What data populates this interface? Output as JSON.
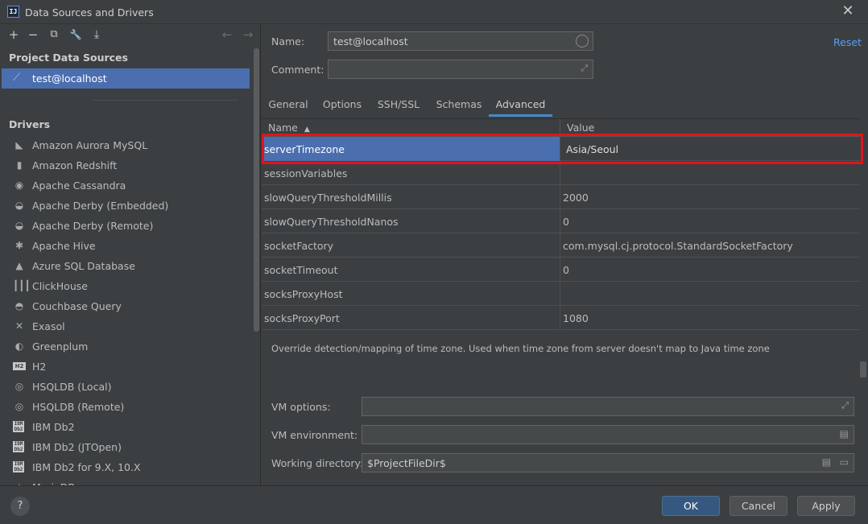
{
  "window": {
    "title": "Data Sources and Drivers",
    "app_icon": "IJ"
  },
  "left_panel": {
    "toolbar": {
      "add": "+",
      "remove": "−",
      "copy": "⧉",
      "properties": "🔧",
      "import": "⤓",
      "back": "←",
      "forward": "→"
    },
    "project_heading": "Project Data Sources",
    "data_sources": [
      {
        "label": "test@localhost",
        "icon": "mysql-icon"
      }
    ],
    "drivers_heading": "Drivers",
    "drivers": [
      {
        "label": "Amazon Aurora MySQL",
        "icon": "aurora-icon",
        "glyph": "◣"
      },
      {
        "label": "Amazon Redshift",
        "icon": "redshift-icon",
        "glyph": "▮"
      },
      {
        "label": "Apache Cassandra",
        "icon": "cassandra-icon",
        "glyph": "◉"
      },
      {
        "label": "Apache Derby (Embedded)",
        "icon": "derby-icon",
        "glyph": "◒"
      },
      {
        "label": "Apache Derby (Remote)",
        "icon": "derby-icon",
        "glyph": "◒"
      },
      {
        "label": "Apache Hive",
        "icon": "hive-icon",
        "glyph": "✱"
      },
      {
        "label": "Azure SQL Database",
        "icon": "azure-icon",
        "glyph": "▲"
      },
      {
        "label": "ClickHouse",
        "icon": "clickhouse-icon",
        "glyph": "┃┃┃"
      },
      {
        "label": "Couchbase Query",
        "icon": "couchbase-icon",
        "glyph": "◓"
      },
      {
        "label": "Exasol",
        "icon": "exasol-icon",
        "glyph": "✕"
      },
      {
        "label": "Greenplum",
        "icon": "greenplum-icon",
        "glyph": "◐"
      },
      {
        "label": "H2",
        "icon": "h2-icon",
        "glyph": "H2"
      },
      {
        "label": "HSQLDB (Local)",
        "icon": "hsqldb-icon",
        "glyph": "◎"
      },
      {
        "label": "HSQLDB (Remote)",
        "icon": "hsqldb-icon",
        "glyph": "◎"
      },
      {
        "label": "IBM Db2",
        "icon": "ibm-icon",
        "glyph": "IBM Db2"
      },
      {
        "label": "IBM Db2 (JTOpen)",
        "icon": "ibm-icon",
        "glyph": "IBM Db2"
      },
      {
        "label": "IBM Db2 for 9.X, 10.X",
        "icon": "ibm-icon",
        "glyph": "IBM Db2"
      },
      {
        "label": "MariaDB",
        "icon": "mariadb-icon",
        "glyph": "≀"
      }
    ]
  },
  "form": {
    "name_label": "Name:",
    "name_value": "test@localhost",
    "comment_label": "Comment:",
    "comment_value": "",
    "reset_link": "Reset",
    "expand_glyph": "⤢"
  },
  "tabs": [
    {
      "label": "General"
    },
    {
      "label": "Options"
    },
    {
      "label": "SSH/SSL"
    },
    {
      "label": "Schemas"
    },
    {
      "label": "Advanced",
      "active": true
    }
  ],
  "table": {
    "col_name": "Name",
    "col_value": "Value",
    "sort_indicator": "▲",
    "rows": [
      {
        "name": "serverTimezone",
        "value": "Asia/Seoul",
        "selected": true
      },
      {
        "name": "sessionVariables",
        "value": ""
      },
      {
        "name": "slowQueryThresholdMillis",
        "value": "2000"
      },
      {
        "name": "slowQueryThresholdNanos",
        "value": "0"
      },
      {
        "name": "socketFactory",
        "value": "com.mysql.cj.protocol.StandardSocketFactory"
      },
      {
        "name": "socketTimeout",
        "value": "0"
      },
      {
        "name": "socksProxyHost",
        "value": ""
      },
      {
        "name": "socksProxyPort",
        "value": "1080"
      }
    ]
  },
  "description": "Override detection/mapping of time zone. Used when time zone from server doesn't map to Java time zone",
  "vm": {
    "options_label": "VM options:",
    "options_value": "",
    "env_label": "VM environment:",
    "env_value": "",
    "workdir_label": "Working directory:",
    "workdir_value": "$ProjectFileDir$"
  },
  "buttons": {
    "help": "?",
    "ok": "OK",
    "cancel": "Cancel",
    "apply": "Apply"
  },
  "colors": {
    "selection": "#4b6eaf",
    "highlight": "#e0141e",
    "link": "#589df6",
    "primary_button": "#365880"
  }
}
